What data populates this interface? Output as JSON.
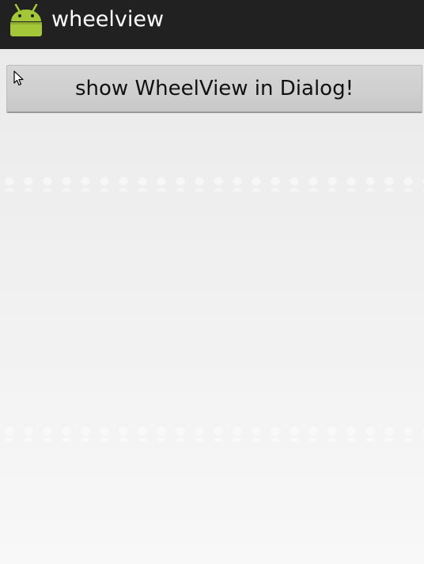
{
  "action_bar": {
    "title": "wheelview",
    "icon": "android-robot-icon",
    "background_color": "#212121",
    "icon_color": "#a4c639"
  },
  "main": {
    "show_button_label": "show WheelView in Dialog!"
  }
}
